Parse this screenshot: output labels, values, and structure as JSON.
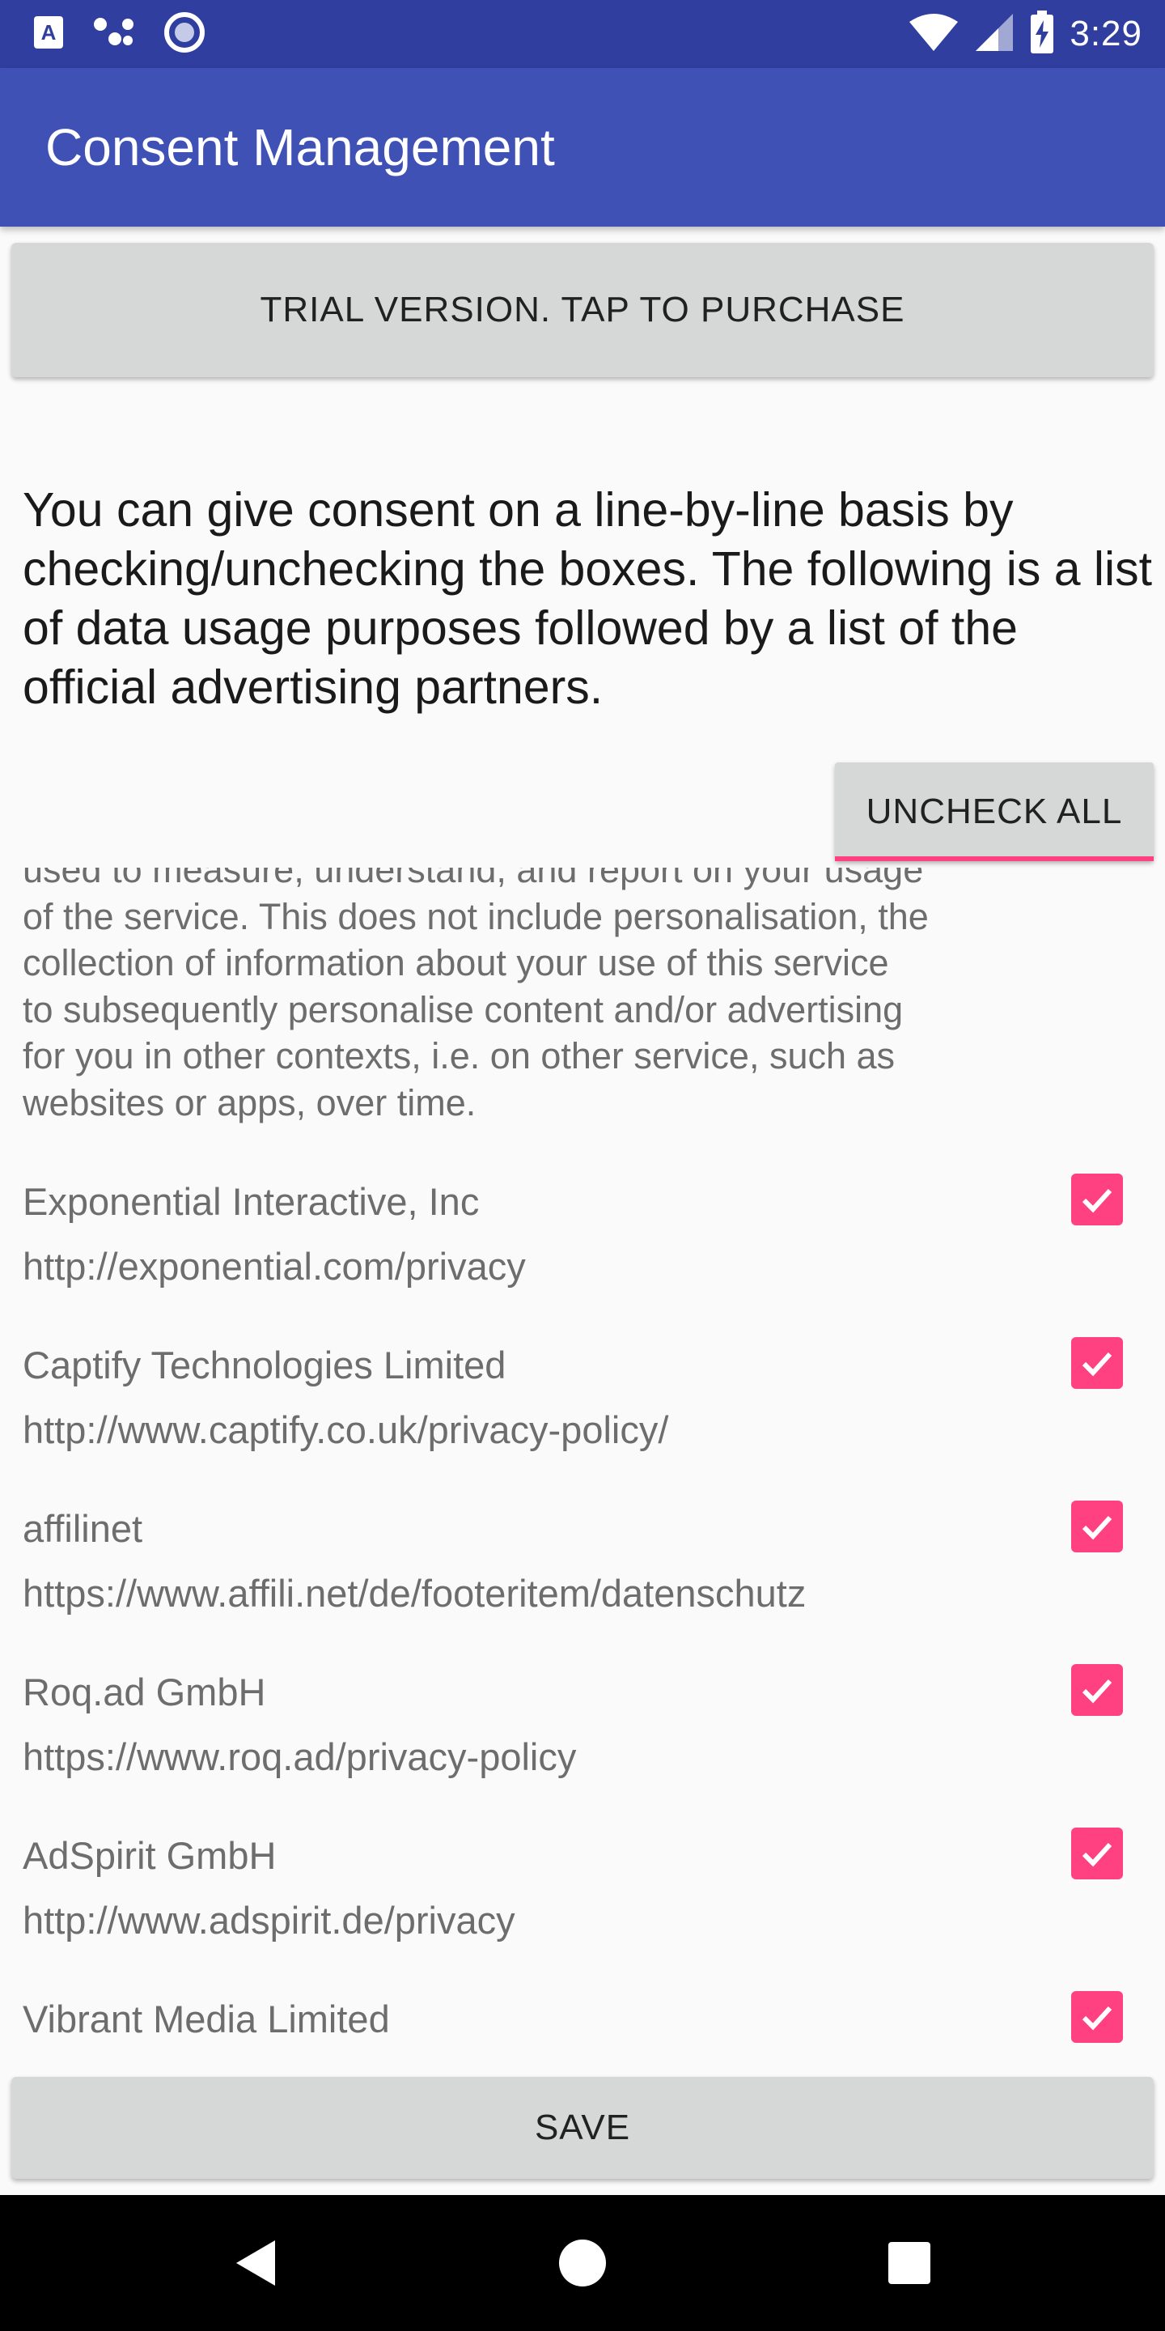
{
  "status_bar": {
    "time": "3:29",
    "left_icons": [
      "a-notification-icon",
      "dots-notification-icon",
      "circle-notification-icon"
    ],
    "right_icons": [
      "wifi-icon",
      "signal-icon",
      "battery-charging-icon"
    ]
  },
  "app_bar": {
    "title": "Consent Management",
    "color": "#3f51b5",
    "status_color": "#303f9f"
  },
  "trial_button": {
    "label": "TRIAL VERSION. TAP TO PURCHASE"
  },
  "intro_text": "You can give consent on a line-by-line basis by checking/unchecking the boxes. The following is a list of data usage purposes followed by a list of the official advertising partners.",
  "uncheck_all_button": {
    "label": "UNCHECK ALL",
    "accent": "#ff4081"
  },
  "purpose_description": {
    "lines": [
      "used to measure, understand, and report on your usage",
      "of the service. This does not include personalisation, the",
      "collection of information about your use of this service",
      "to subsequently personalise content and/or advertising",
      "for you in other contexts, i.e. on other service, such as",
      "websites or apps, over time."
    ]
  },
  "vendors": [
    {
      "name": "Exponential Interactive, Inc",
      "url": "http://exponential.com/privacy",
      "checked": true
    },
    {
      "name": "Captify Technologies Limited",
      "url": "http://www.captify.co.uk/privacy-policy/",
      "checked": true
    },
    {
      "name": "affilinet",
      "url": "https://www.affili.net/de/footeritem/datenschutz",
      "checked": true
    },
    {
      "name": "Roq.ad GmbH",
      "url": "https://www.roq.ad/privacy-policy",
      "checked": true
    },
    {
      "name": "AdSpirit GmbH",
      "url": "http://www.adspirit.de/privacy",
      "checked": true
    },
    {
      "name": "Vibrant Media Limited",
      "url": "",
      "checked": true
    }
  ],
  "save_button": {
    "label": "SAVE"
  },
  "nav_bar": {
    "icons": [
      "back-icon",
      "home-icon",
      "recents-icon"
    ]
  }
}
